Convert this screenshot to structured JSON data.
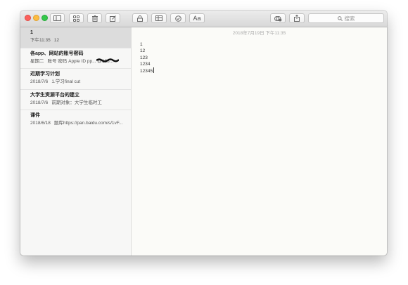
{
  "toolbar": {
    "buttons": [
      {
        "icon": "sidebar-toggle-icon"
      },
      {
        "icon": "attachments-grid-icon"
      },
      {
        "icon": "trash-icon"
      },
      {
        "icon": "compose-icon"
      },
      {
        "icon": "lock-icon"
      },
      {
        "icon": "table-icon"
      },
      {
        "icon": "checklist-icon"
      },
      {
        "icon": "format-text-icon",
        "label": "Aa"
      },
      {
        "icon": "add-people-icon"
      },
      {
        "icon": "share-icon"
      }
    ],
    "search": {
      "placeholder": "搜索",
      "icon": "search-icon"
    }
  },
  "notes": [
    {
      "title": "1",
      "date": "下午11:35",
      "preview": "12",
      "selected": true
    },
    {
      "title": "各app、网站的账号密码",
      "date": "星期二",
      "preview": "账号 密码 Apple ID pp... @163...",
      "selected": false
    },
    {
      "title": "近期学习计划",
      "date": "2018/7/6",
      "preview": "1.学习final cut",
      "selected": false
    },
    {
      "title": "大学生资源平台的建立",
      "date": "2018/7/6",
      "preview": "前期对象：大学生临时工",
      "selected": false
    },
    {
      "title": "课件",
      "date": "2018/6/18",
      "preview": "题库https://pan.baidu.com/s/1vF...",
      "selected": false
    }
  ],
  "editor": {
    "date": "2018年7月19日 下午11:35",
    "lines": [
      "1",
      "12",
      "123",
      "1234",
      "12345"
    ]
  },
  "colors": {
    "close": "#fc605c",
    "minimize": "#fdbc40",
    "maximize": "#34c84a",
    "selected_note_bg": "#dcdcdc",
    "paper": "#fbfbf8"
  }
}
